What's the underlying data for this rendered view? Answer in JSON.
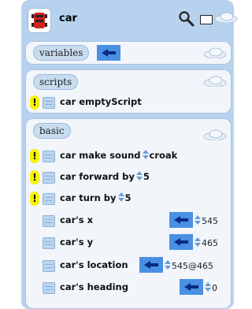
{
  "title": "car",
  "sections": {
    "variables": {
      "label": "variables"
    },
    "scripts": {
      "label": "scripts",
      "rows": [
        {
          "label": "car emptyScript"
        }
      ]
    },
    "basic": {
      "label": "basic",
      "rows": [
        {
          "prefix": "car make sound",
          "value": "croak"
        },
        {
          "prefix": "car forward by",
          "value": "5"
        },
        {
          "prefix": "car turn by",
          "value": "5"
        },
        {
          "label": "car's x",
          "value": "545"
        },
        {
          "label": "car's y",
          "value": "465"
        },
        {
          "label": "car's location",
          "value": "545@465"
        },
        {
          "label": "car's heading",
          "value": "0"
        }
      ]
    }
  },
  "icons": {
    "logo": "car-icon",
    "search": "search-icon",
    "keyboard": "keyboard-icon",
    "cloud": "cloud-icon",
    "warning": "warning-icon",
    "block": "block-icon",
    "watch": "watcher-arrow-icon"
  },
  "colors": {
    "panel": "#b7d2ee",
    "watch": "#4a90e2",
    "warning": "#f6f200"
  }
}
